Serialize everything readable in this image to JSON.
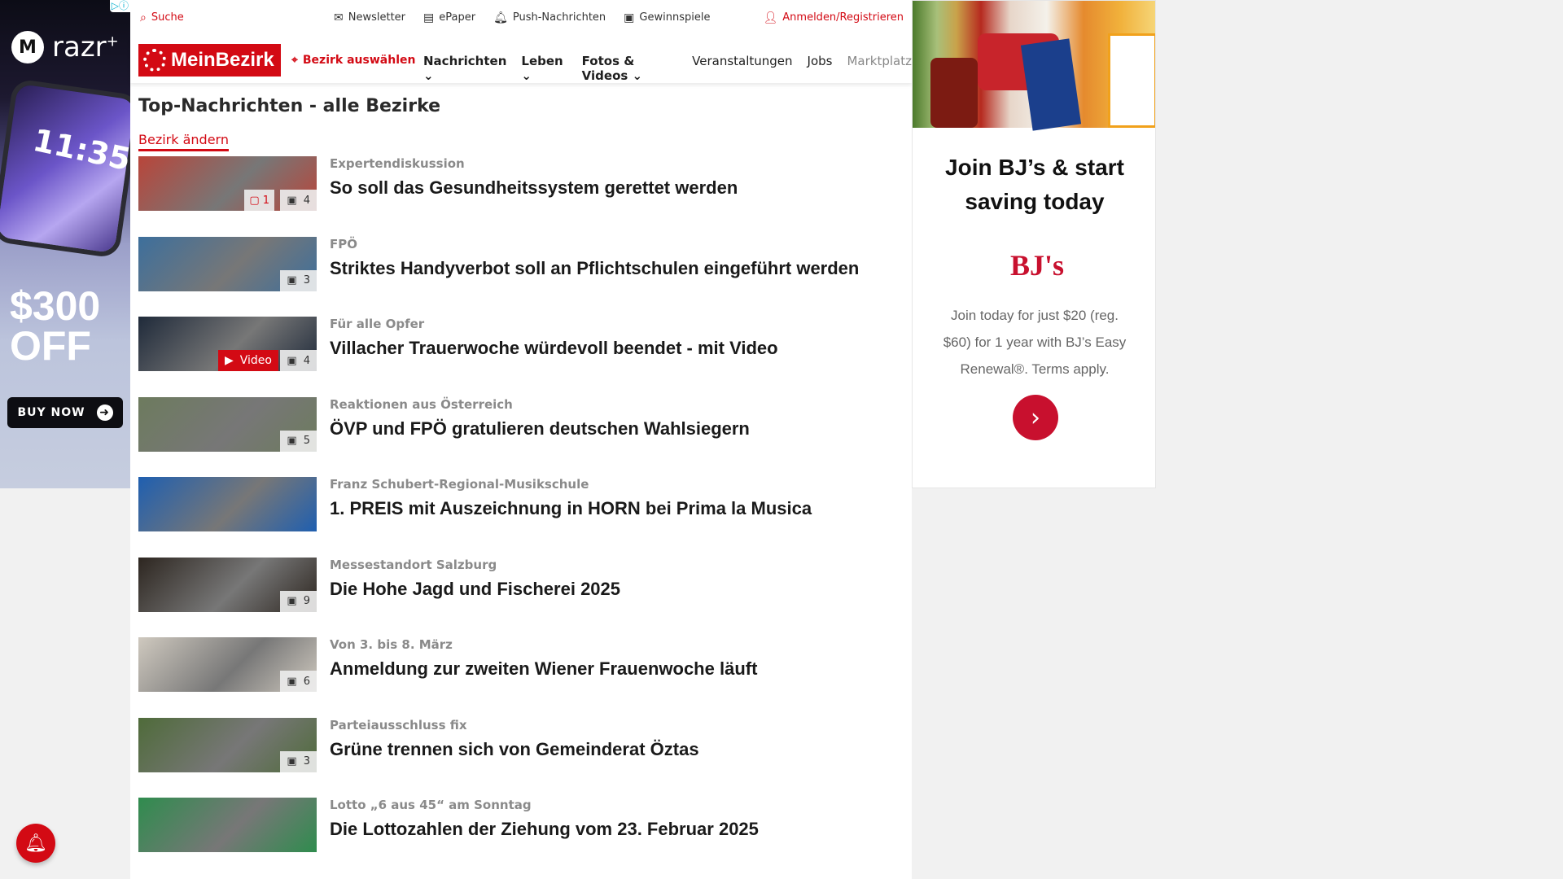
{
  "topbar": {
    "search_label": "Suche",
    "links": [
      "Newsletter",
      "ePaper",
      "Push-Nachrichten",
      "Gewinnspiele"
    ],
    "login_label": "Anmelden/Registrieren"
  },
  "nav": {
    "logo_text": "MeinBezirk",
    "bezirk_label": "Bezirk auswählen",
    "items": [
      "Nachrichten",
      "Leben",
      "Fotos & Videos",
      "Veranstaltungen",
      "Jobs",
      "Marktplatz"
    ]
  },
  "page": {
    "heading": "Top-Nachrichten - alle Bezirke",
    "change_link": "Bezirk ändern"
  },
  "articles": [
    {
      "kicker": "Expertendiskussion",
      "title": "So soll das Gesundheitssystem gerettet werden",
      "comments": "1",
      "images": "4",
      "thumb_color": "#b9453a"
    },
    {
      "kicker": "FPÖ",
      "title": "Striktes Handyverbot soll an Pflichtschulen eingeführt werden",
      "images": "3",
      "thumb_color": "#3d6f9c"
    },
    {
      "kicker": "Für alle Opfer",
      "title": "Villacher Trauerwoche würdevoll beendet - mit Video",
      "video": "Video",
      "images": "4",
      "thumb_color": "#1f2a3a"
    },
    {
      "kicker": "Reaktionen aus Österreich",
      "title": "ÖVP und FPÖ gratulieren deutschen Wahlsiegern",
      "images": "5",
      "thumb_color": "#6d7b5e"
    },
    {
      "kicker": "Franz Schubert-Regional-Musikschule",
      "title": "1. PREIS mit Auszeichnung in HORN bei Prima la Musica",
      "thumb_color": "#1f5fb0"
    },
    {
      "kicker": "Messestandort Salzburg",
      "title": "Die Hohe Jagd und Fischerei 2025",
      "images": "9",
      "thumb_color": "#2d2620"
    },
    {
      "kicker": "Von 3. bis 8. März",
      "title": "Anmeldung zur zweiten Wiener Frauenwoche läuft",
      "images": "6",
      "thumb_color": "#cfc9bf"
    },
    {
      "kicker": "Parteiausschluss fix",
      "title": "Grüne trennen sich von Gemeinderat Öztas",
      "images": "3",
      "thumb_color": "#4f6b3a"
    },
    {
      "kicker": "Lotto „6 aus 45“ am Sonntag",
      "title": "Die Lottozahlen der Ziehung vom 23. Februar 2025",
      "thumb_color": "#2f8c4e"
    }
  ],
  "ad_left": {
    "brand": "razr",
    "brand_sup": "+",
    "time": "11:35",
    "offer_line1": "$300",
    "offer_line2": "OFF",
    "button": "BUY NOW"
  },
  "ad_right": {
    "headline": "Join BJ’s & start saving today",
    "logo": "BJ's",
    "copy": "Join today for just $20 (reg. $60) for 1 year with BJ’s Easy Renewal®. Terms apply."
  },
  "colors": {
    "accent": "#d30a14",
    "ad_red": "#c8102e"
  }
}
